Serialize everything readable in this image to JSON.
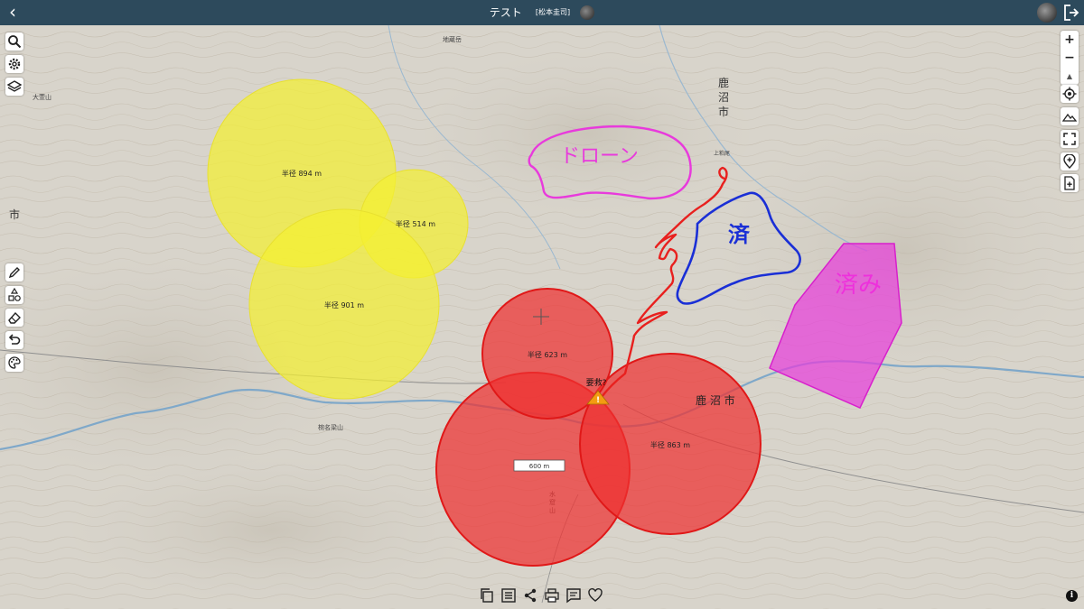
{
  "header": {
    "title": "テスト",
    "owner": "[松本圭司]"
  },
  "map": {
    "place_labels": {
      "kanuma_city_v1": "鹿",
      "kanuma_city_v2": "沼",
      "kanuma_city_v3": "市",
      "kanuma_city_h": "鹿 沼 市",
      "left_city": "市",
      "mt_otaki": "大萱山",
      "mt_haruna": "椀名梁山",
      "mt_suikyu": "水",
      "mt_suikyu2": "窟",
      "mt_suikyu3": "山",
      "jizo": "地蔵岳",
      "kamiasai": "上粕尾"
    },
    "circles": [
      {
        "label": "半径 894 m",
        "color": "#f2ef3a"
      },
      {
        "label": "半径 514 m",
        "color": "#f2ef3a"
      },
      {
        "label": "半径 901 m",
        "color": "#f2ef3a"
      },
      {
        "label": "半径 623 m",
        "color": "#ee3030"
      },
      {
        "label": "半径 863 m",
        "color": "#ee3030"
      }
    ],
    "measure_label": "600 m",
    "marker_label": "要救?",
    "handwritten": {
      "drone": "ドローン",
      "done1": "済",
      "done2": "済み"
    }
  },
  "toolbar_left": [
    "search-icon",
    "settings-icon",
    "layers-icon"
  ],
  "drawing_tools": [
    "pencil-icon",
    "shapes-icon",
    "eraser-icon",
    "undo-icon",
    "palette-icon"
  ],
  "map_controls": {
    "zoom_in": "+",
    "zoom_out": "−",
    "north": "▲"
  },
  "bottom_actions": [
    "copy-icon",
    "list-icon",
    "share-icon",
    "print-icon",
    "comment-icon",
    "heart-icon"
  ],
  "info": "i"
}
